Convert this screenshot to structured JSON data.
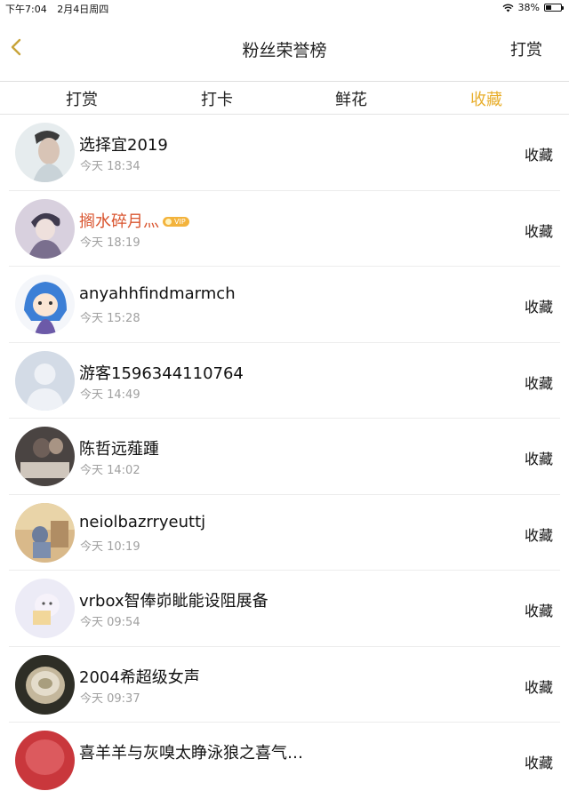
{
  "status_bar": {
    "time": "下午7:04",
    "date": "2月4日周四",
    "battery": "38%",
    "battery_level": 0.38
  },
  "nav": {
    "title": "粉丝荣誉榜",
    "action": "打赏",
    "back_icon": "chevron-left-icon"
  },
  "tabs": [
    {
      "label": "打赏"
    },
    {
      "label": "打卡"
    },
    {
      "label": "鲜花"
    },
    {
      "label": "收藏",
      "active": true
    }
  ],
  "accent_color": "#e8ae2c",
  "vip_name_color": "#d9542e",
  "vip_badge": "VIP",
  "rows": [
    {
      "name": "选择宜2019",
      "time": "今天 18:34",
      "action": "收藏"
    },
    {
      "name": "搁水碎月灬",
      "time": "今天 18:19",
      "action": "收藏",
      "vip": true
    },
    {
      "name": "anyahhfindmarmch",
      "time": "今天 15:28",
      "action": "收藏"
    },
    {
      "name": "游客1596344110764",
      "time": "今天 14:49",
      "action": "收藏"
    },
    {
      "name": "陈哲远薤踵",
      "time": "今天 14:02",
      "action": "收藏"
    },
    {
      "name": "neiolbazrryeuttj",
      "time": "今天 10:19",
      "action": "收藏"
    },
    {
      "name": "vrbox智俸峁眦能设阻展备",
      "time": "今天 09:54",
      "action": "收藏"
    },
    {
      "name": "2004希超级女声",
      "time": "今天 09:37",
      "action": "收藏"
    },
    {
      "name": "喜羊羊与灰嗅太睁泳狼之喜气…",
      "time": "",
      "action": "收藏"
    }
  ]
}
